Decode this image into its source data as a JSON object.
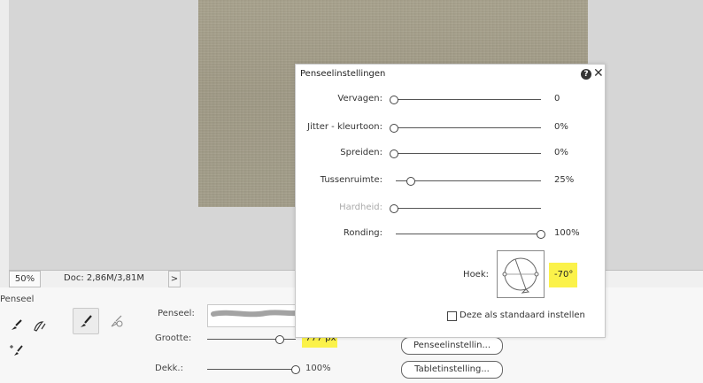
{
  "status": {
    "zoom": "50%",
    "doc": "Doc: 2,86M/3,81M",
    "arrow": ">"
  },
  "tool_panel": {
    "title": "Penseel",
    "brush_label": "Penseel:",
    "size_label": "Grootte:",
    "size_value": "777 px",
    "size_level": 0.82,
    "opacity_label": "Dekk.:",
    "opacity_value": "100%",
    "opacity_level": 1.0,
    "brush_settings_button": "Penseelinstellin...",
    "tablet_settings_button": "Tabletinstelling..."
  },
  "dialog": {
    "title": "Penseelinstellingen",
    "rows": [
      {
        "label": "Vervagen:",
        "value": "0",
        "level": 0
      },
      {
        "label": "Jitter - kleurtoon:",
        "value": "0%",
        "level": 0
      },
      {
        "label": "Spreiden:",
        "value": "0%",
        "level": 0
      },
      {
        "label": "Tussenruimte:",
        "value": "25%",
        "level": 0.25
      },
      {
        "label": "Hardheid:",
        "value": "",
        "level": 0,
        "disabled": true
      },
      {
        "label": "Ronding:",
        "value": "100%",
        "level": 1.0
      }
    ],
    "angle_label": "Hoek:",
    "angle_value": "-70°",
    "default_checkbox": "Deze als standaard instellen",
    "help_icon": "help-icon",
    "close_icon": "close-icon"
  },
  "colors": {
    "highlight": "#fbf24a",
    "canvas": "#d6d6d6"
  }
}
